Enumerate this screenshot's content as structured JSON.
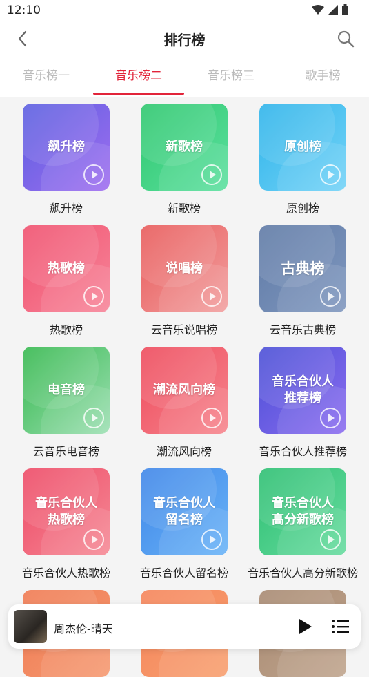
{
  "status": {
    "time": "12:10"
  },
  "header": {
    "title": "排行榜"
  },
  "tabs": [
    {
      "label": "音乐榜一"
    },
    {
      "label": "音乐榜二"
    },
    {
      "label": "音乐榜三"
    },
    {
      "label": "歌手榜"
    }
  ],
  "cards": [
    {
      "cover": "飙升榜",
      "label": "飙升榜",
      "colors": [
        "#5b5fe0",
        "#a06ef0"
      ]
    },
    {
      "cover": "新歌榜",
      "label": "新歌榜",
      "colors": [
        "#2ec76e",
        "#5de0a0"
      ]
    },
    {
      "cover": "原创榜",
      "label": "原创榜",
      "colors": [
        "#2fb4ea",
        "#74d3f7"
      ]
    },
    {
      "cover": "热歌榜",
      "label": "热歌榜",
      "colors": [
        "#f0506e",
        "#f7869a"
      ]
    },
    {
      "cover": "说唱榜",
      "label": "云音乐说唱榜",
      "colors": [
        "#e85a5a",
        "#f2a0a0"
      ]
    },
    {
      "cover": "古典榜",
      "label": "云音乐古典榜",
      "colors": [
        "#5f7aa6",
        "#8098bf"
      ]
    },
    {
      "cover": "电音榜",
      "label": "云音乐电音榜",
      "colors": [
        "#35b84e",
        "#9ee0b4"
      ]
    },
    {
      "cover": "潮流风向榜",
      "label": "潮流风向榜",
      "colors": [
        "#ee4a5c",
        "#f6868e"
      ]
    },
    {
      "cover": "音乐合伙人\n推荐榜",
      "label": "音乐合伙人推荐榜",
      "colors": [
        "#4a4fd6",
        "#8c6df0"
      ]
    },
    {
      "cover": "音乐合伙人\n热歌榜",
      "label": "音乐合伙人热歌榜",
      "colors": [
        "#ee4a66",
        "#f58a96"
      ]
    },
    {
      "cover": "音乐合伙人\n留名榜",
      "label": "音乐合伙人留名榜",
      "colors": [
        "#3f86e8",
        "#6ab4f7"
      ]
    },
    {
      "cover": "音乐合伙人\n高分新歌榜",
      "label": "音乐合伙人高分新歌榜",
      "colors": [
        "#2dbf72",
        "#68dca0"
      ]
    }
  ],
  "partial_cards": [
    {
      "colors": [
        "#f07a52",
        "#f59a72"
      ]
    },
    {
      "colors": [
        "#f5845a",
        "#f8a070"
      ]
    },
    {
      "colors": [
        "#a88a72",
        "#c0a58e"
      ]
    }
  ],
  "player": {
    "song": "周杰伦-晴天"
  }
}
